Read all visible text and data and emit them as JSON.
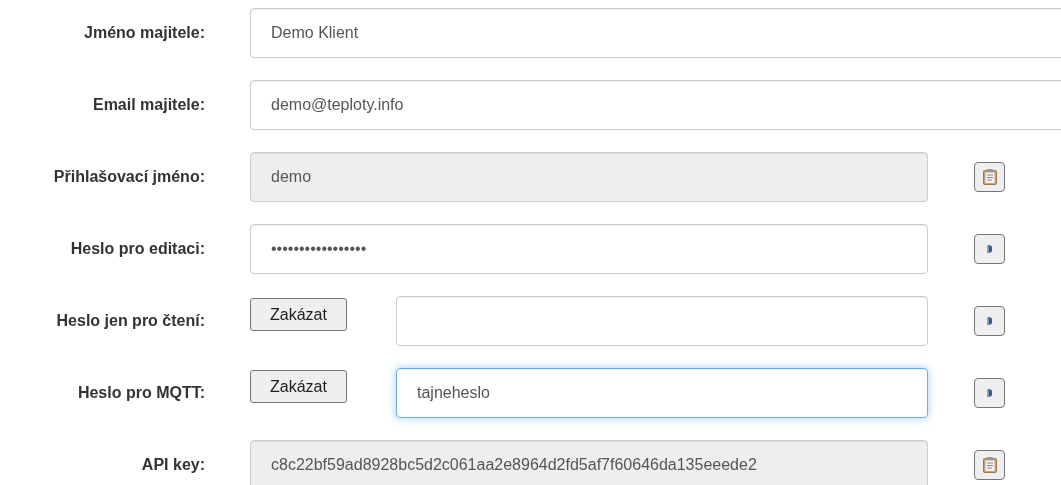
{
  "rows": [
    {
      "label": "Jméno majitele:",
      "field": {
        "value": "Demo Klient",
        "disabled": false,
        "focused": false
      }
    },
    {
      "label": "Email majitele:",
      "field": {
        "value": "demo@teploty.info",
        "disabled": false,
        "focused": false
      }
    },
    {
      "label": "Přihlašovací jméno:",
      "field": {
        "value": "demo",
        "disabled": true,
        "focused": false
      },
      "action": {
        "kind": "copy"
      }
    },
    {
      "label": "Heslo pro editaci:",
      "field": {
        "value": "•••••••••••••••••",
        "disabled": false,
        "focused": false
      },
      "action": {
        "kind": "reveal"
      }
    },
    {
      "label": "Heslo jen pro čtení:",
      "toggle": "Zakázat",
      "field": {
        "disabled": false,
        "focused": false
      },
      "action": {
        "kind": "reveal"
      }
    },
    {
      "label": "Heslo pro MQTT:",
      "toggle": "Zakázat",
      "field": {
        "value": "tajneheslo",
        "disabled": false,
        "focused": true
      },
      "action": {
        "kind": "reveal"
      }
    },
    {
      "label": "API key:",
      "field": {
        "value": "c8c22bf59ad8928bc5d2c061aa2e8964d2fd5af7f60646da135eeede2",
        "disabled": true,
        "focused": false
      },
      "action": {
        "kind": "copy"
      }
    }
  ]
}
